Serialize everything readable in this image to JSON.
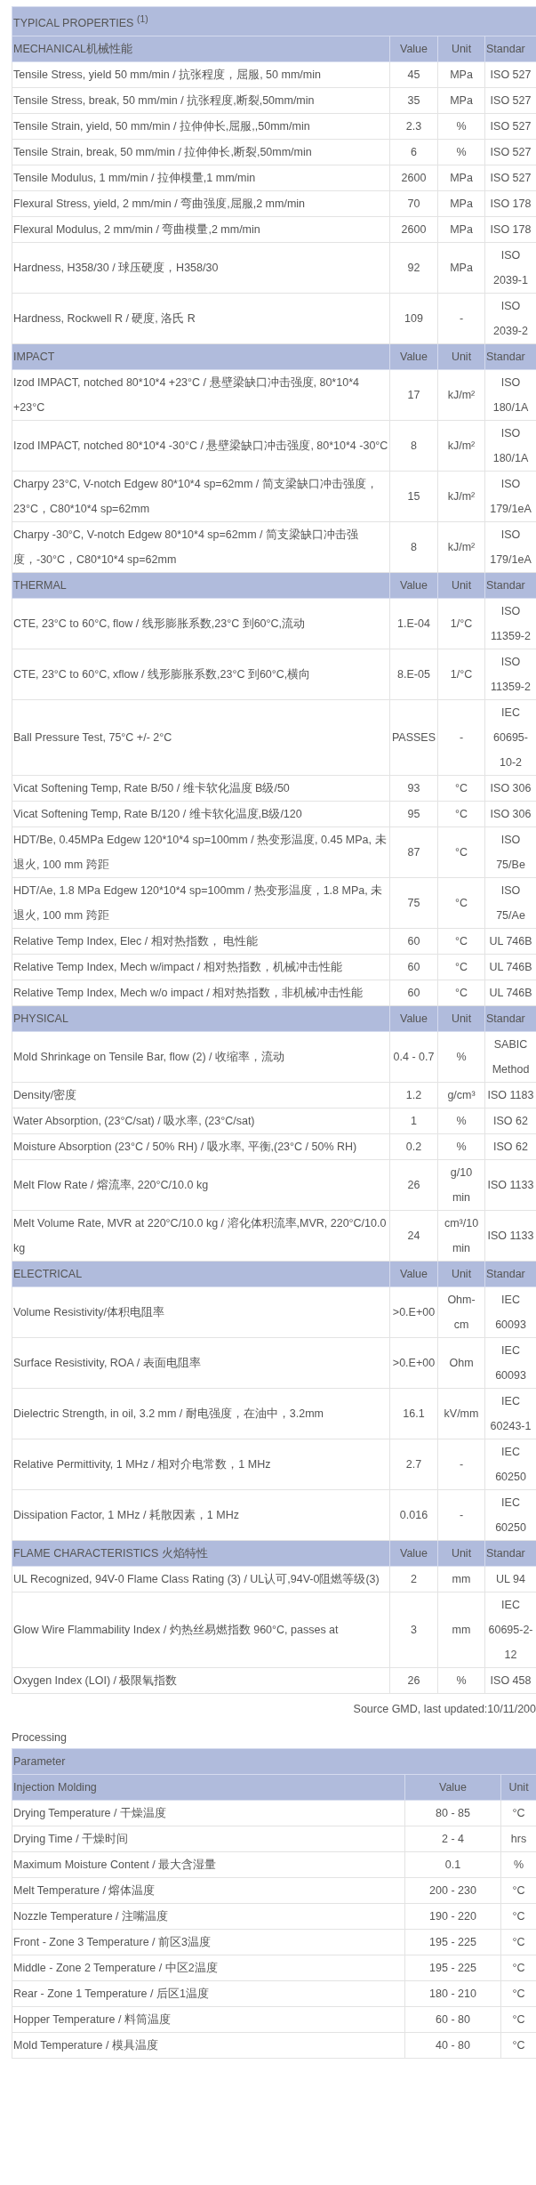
{
  "properties_table": {
    "title": "TYPICAL PROPERTIES $^{(1)}$",
    "sections": [
      {
        "name": "MECHANICAL机械性能",
        "columns": [
          "Value",
          "Unit",
          "Standar"
        ],
        "rows": [
          {
            "property": "Tensile Stress, yield 50 mm/min / 抗张程度，屈服, 50 mm/min",
            "value": "45",
            "unit": "MPa",
            "standard": "ISO 527"
          },
          {
            "property": "Tensile Stress, break, 50 mm/min / 抗张程度,断裂,50mm/min",
            "value": "35",
            "unit": "MPa",
            "standard": "ISO 527"
          },
          {
            "property": "Tensile Strain, yield, 50 mm/min / 拉伸伸长,屈服,,50mm/min",
            "value": "2.3",
            "unit": "%",
            "standard": "ISO 527"
          },
          {
            "property": "Tensile Strain, break, 50 mm/min / 拉伸伸长,断裂,50mm/min",
            "value": "6",
            "unit": "%",
            "standard": "ISO 527"
          },
          {
            "property": "Tensile Modulus, 1 mm/min / 拉伸模量,1 mm/min",
            "value": "2600",
            "unit": "MPa",
            "standard": "ISO 527"
          },
          {
            "property": "Flexural Stress, yield, 2 mm/min / 弯曲强度,屈服,2 mm/min",
            "value": "70",
            "unit": "MPa",
            "standard": "ISO 178"
          },
          {
            "property": "Flexural Modulus, 2 mm/min / 弯曲模量,2 mm/min",
            "value": "2600",
            "unit": "MPa",
            "standard": "ISO 178"
          },
          {
            "property": "Hardness, H358/30 / 球压硬度，H358/30",
            "value": "92",
            "unit": "MPa",
            "standard": "ISO 2039-1"
          },
          {
            "property": "Hardness, Rockwell R / 硬度, 洛氏 R",
            "value": "109",
            "unit": "-",
            "standard": "ISO 2039-2"
          }
        ]
      },
      {
        "name": "IMPACT",
        "columns": [
          "Value",
          "Unit",
          "Standar"
        ],
        "rows": [
          {
            "property": "Izod IMPACT, notched 80*10*4 +23°C / 悬壁梁缺口冲击强度, 80*10*4 +23°C",
            "value": "17",
            "unit": "kJ/m²",
            "standard": "ISO 180/1A"
          },
          {
            "property": "Izod IMPACT, notched 80*10*4 -30°C / 悬壁梁缺口冲击强度, 80*10*4 -30°C",
            "value": "8",
            "unit": "kJ/m²",
            "standard": "ISO 180/1A"
          },
          {
            "property": "Charpy 23°C, V-notch Edgew 80*10*4 sp=62mm / 简支梁缺口冲击强度，23°C，C80*10*4 sp=62mm",
            "value": "15",
            "unit": "kJ/m²",
            "standard": "ISO 179/1eA"
          },
          {
            "property": "Charpy -30°C, V-notch Edgew 80*10*4 sp=62mm / 简支梁缺口冲击强度，-30°C，C80*10*4 sp=62mm",
            "value": "8",
            "unit": "kJ/m²",
            "standard": "ISO 179/1eA"
          }
        ]
      },
      {
        "name": "THERMAL",
        "columns": [
          "Value",
          "Unit",
          "Standar"
        ],
        "rows": [
          {
            "property": "CTE, 23°C to 60°C, flow / 线形膨胀系数,23°C 到60°C,流动",
            "value": "1.E-04",
            "unit": "1/°C",
            "standard": "ISO 11359-2"
          },
          {
            "property": "CTE, 23°C to 60°C, xflow / 线形膨胀系数,23°C 到60°C,横向",
            "value": "8.E-05",
            "unit": "1/°C",
            "standard": "ISO 11359-2"
          },
          {
            "property": "Ball Pressure Test, 75°C +/- 2°C",
            "value": "PASSES",
            "unit": "-",
            "standard": "IEC 60695-10-2"
          },
          {
            "property": "Vicat Softening Temp, Rate B/50 / 维卡软化温度 B级/50",
            "value": "93",
            "unit": "°C",
            "standard": "ISO 306"
          },
          {
            "property": "Vicat Softening Temp, Rate B/120 / 维卡软化温度,B级/120",
            "value": "95",
            "unit": "°C",
            "standard": "ISO 306"
          },
          {
            "property": "HDT/Be, 0.45MPa Edgew 120*10*4 sp=100mm / 热变形温度, 0.45 MPa, 未退火, 100 mm 跨距",
            "value": "87",
            "unit": "°C",
            "standard": "ISO 75/Be"
          },
          {
            "property": "HDT/Ae, 1.8 MPa Edgew 120*10*4 sp=100mm / 热变形温度，1.8 MPa, 未退火, 100 mm 跨距",
            "value": "75",
            "unit": "°C",
            "standard": "ISO 75/Ae"
          },
          {
            "property": "Relative Temp Index, Elec / 相对热指数， 电性能",
            "value": "60",
            "unit": "°C",
            "standard": "UL 746B"
          },
          {
            "property": "Relative Temp Index, Mech w/impact / 相对热指数，机械冲击性能",
            "value": "60",
            "unit": "°C",
            "standard": "UL 746B"
          },
          {
            "property": "Relative Temp Index, Mech w/o impact / 相对热指数，非机械冲击性能",
            "value": "60",
            "unit": "°C",
            "standard": "UL 746B"
          }
        ]
      },
      {
        "name": "PHYSICAL",
        "columns": [
          "Value",
          "Unit",
          "Standar"
        ],
        "rows": [
          {
            "property": "Mold Shrinkage on Tensile Bar, flow (2) / 收缩率，流动",
            "value": "0.4 - 0.7",
            "unit": "%",
            "standard": "SABIC Method"
          },
          {
            "property": "Density/密度",
            "value": "1.2",
            "unit": "g/cm³",
            "standard": "ISO 1183"
          },
          {
            "property": "Water Absorption, (23°C/sat) / 吸水率, (23°C/sat)",
            "value": "1",
            "unit": "%",
            "standard": "ISO 62"
          },
          {
            "property": "Moisture Absorption (23°C / 50% RH) / 吸水率, 平衡,(23°C / 50% RH)",
            "value": "0.2",
            "unit": "%",
            "standard": "ISO 62"
          },
          {
            "property": "Melt Flow Rate / 熔流率, 220°C/10.0 kg",
            "value": "26",
            "unit": "g/10 min",
            "standard": "ISO 1133"
          },
          {
            "property": "Melt Volume Rate, MVR at 220°C/10.0 kg / 溶化体积流率,MVR, 220°C/10.0 kg",
            "value": "24",
            "unit": "cm³/10 min",
            "standard": "ISO 1133"
          }
        ]
      },
      {
        "name": "ELECTRICAL",
        "columns": [
          "Value",
          "Unit",
          "Standar"
        ],
        "rows": [
          {
            "property": "Volume Resistivity/体积电阻率",
            "value": ">0.E+00",
            "unit": "Ohm-cm",
            "standard": "IEC 60093"
          },
          {
            "property": "Surface Resistivity, ROA / 表面电阻率",
            "value": ">0.E+00",
            "unit": "Ohm",
            "standard": "IEC 60093"
          },
          {
            "property": "Dielectric Strength, in oil, 3.2 mm / 耐电强度，在油中，3.2mm",
            "value": "16.1",
            "unit": "kV/mm",
            "standard": "IEC 60243-1"
          },
          {
            "property": "Relative Permittivity, 1 MHz / 相对介电常数，1 MHz",
            "value": "2.7",
            "unit": "-",
            "standard": "IEC 60250"
          },
          {
            "property": "Dissipation Factor, 1 MHz / 耗散因素，1 MHz",
            "value": "0.016",
            "unit": "-",
            "standard": "IEC 60250"
          }
        ]
      },
      {
        "name": "FLAME CHARACTERISTICS 火焰特性",
        "columns": [
          "Value",
          "Unit",
          "Standar"
        ],
        "rows": [
          {
            "property": "UL Recognized, 94V-0 Flame Class Rating (3) / UL认可,94V-0阻燃等级(3)",
            "value": "2",
            "unit": "mm",
            "standard": "UL 94"
          },
          {
            "property": "Glow Wire Flammability Index / 灼热丝易燃指数 960°C, passes at",
            "value": "3",
            "unit": "mm",
            "standard": "IEC 60695-2-12"
          },
          {
            "property": "Oxygen Index (LOI) / 极限氧指数",
            "value": "26",
            "unit": "%",
            "standard": "ISO 458"
          }
        ]
      }
    ]
  },
  "source_note": "Source GMD, last updated:10/11/200",
  "processing": {
    "title": "Processing",
    "header": "Parameter",
    "group": "Injection Molding",
    "columns": [
      "Value",
      "Unit"
    ],
    "rows": [
      {
        "parameter": "Drying Temperature / 干燥温度",
        "value": "80 - 85",
        "unit": "°C"
      },
      {
        "parameter": "Drying Time / 干燥时间",
        "value": "2 - 4",
        "unit": "hrs"
      },
      {
        "parameter": "Maximum Moisture Content / 最大含湿量",
        "value": "0.1",
        "unit": "%"
      },
      {
        "parameter": "Melt Temperature / 熔体温度",
        "value": "200 - 230",
        "unit": "°C"
      },
      {
        "parameter": "Nozzle Temperature / 注嘴温度",
        "value": "190 - 220",
        "unit": "°C"
      },
      {
        "parameter": "Front - Zone 3 Temperature / 前区3温度",
        "value": "195 - 225",
        "unit": "°C"
      },
      {
        "parameter": "Middle - Zone 2 Temperature / 中区2温度",
        "value": "195 - 225",
        "unit": "°C"
      },
      {
        "parameter": "Rear - Zone 1 Temperature / 后区1温度",
        "value": "180 - 210",
        "unit": "°C"
      },
      {
        "parameter": "Hopper Temperature / 料筒温度",
        "value": "60 - 80",
        "unit": "°C"
      },
      {
        "parameter": "Mold Temperature / 模具温度",
        "value": "40 - 80",
        "unit": "°C"
      }
    ]
  }
}
